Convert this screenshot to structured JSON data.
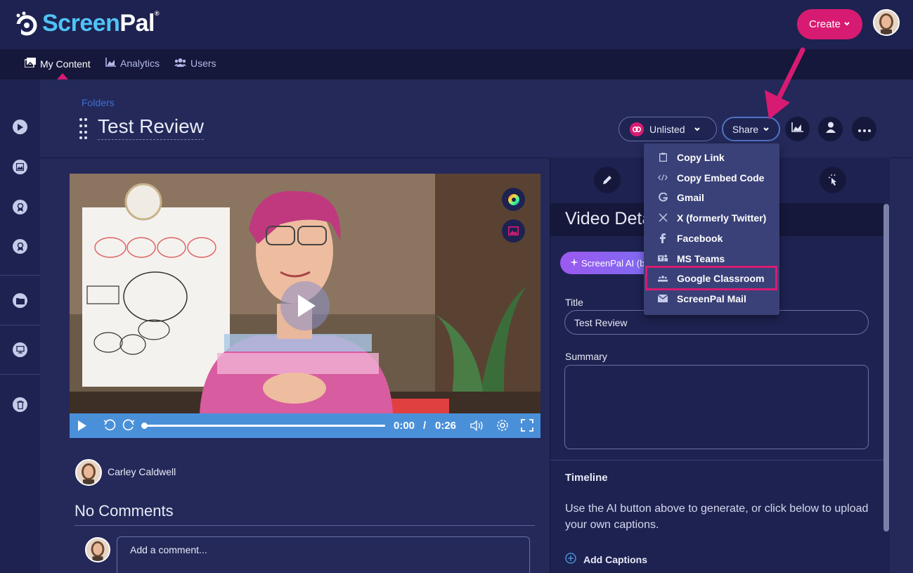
{
  "brand": {
    "name_part1": "Screen",
    "name_part2": "Pal",
    "reg": "®"
  },
  "header": {
    "create_label": "Create"
  },
  "nav": {
    "items": [
      {
        "label": "My Content",
        "icon": "images-icon"
      },
      {
        "label": "Analytics",
        "icon": "chart-icon"
      },
      {
        "label": "Users",
        "icon": "users-icon"
      }
    ]
  },
  "page": {
    "breadcrumb": "Folders",
    "title": "Test Review",
    "visibility_label": "Unlisted",
    "share_label": "Share"
  },
  "share_menu": {
    "items": [
      {
        "label": "Copy Link",
        "icon": "clipboard-icon"
      },
      {
        "label": "Copy Embed Code",
        "icon": "code-icon"
      },
      {
        "label": "Gmail",
        "icon": "google-icon"
      },
      {
        "label": "X (formerly Twitter)",
        "icon": "x-icon"
      },
      {
        "label": "Facebook",
        "icon": "facebook-icon"
      },
      {
        "label": "MS Teams",
        "icon": "teams-icon"
      },
      {
        "label": "Google Classroom",
        "icon": "classroom-icon"
      },
      {
        "label": "ScreenPal Mail",
        "icon": "mail-icon"
      }
    ],
    "highlighted": "Google Classroom"
  },
  "player": {
    "current_time": "0:00",
    "separator": "/",
    "duration": "0:26",
    "progress": 0
  },
  "video_info": {
    "author": "Carley Caldwell",
    "comments_heading": "No Comments",
    "comment_placeholder": "Add a comment..."
  },
  "details": {
    "heading": "Video Deta",
    "ai_button": "ScreenPal AI (b",
    "title_label": "Title",
    "title_value": "Test Review",
    "summary_label": "Summary",
    "summary_value": "",
    "timeline_heading": "Timeline",
    "timeline_text": "Use the AI button above to generate, or click below to upload your own captions.",
    "add_captions": "Add Captions"
  },
  "colors": {
    "accent": "#d81b72",
    "background": "#24295a",
    "header": "#1e2250",
    "player_bar": "#4a90d9",
    "brand_blue": "#4fc3f7"
  }
}
